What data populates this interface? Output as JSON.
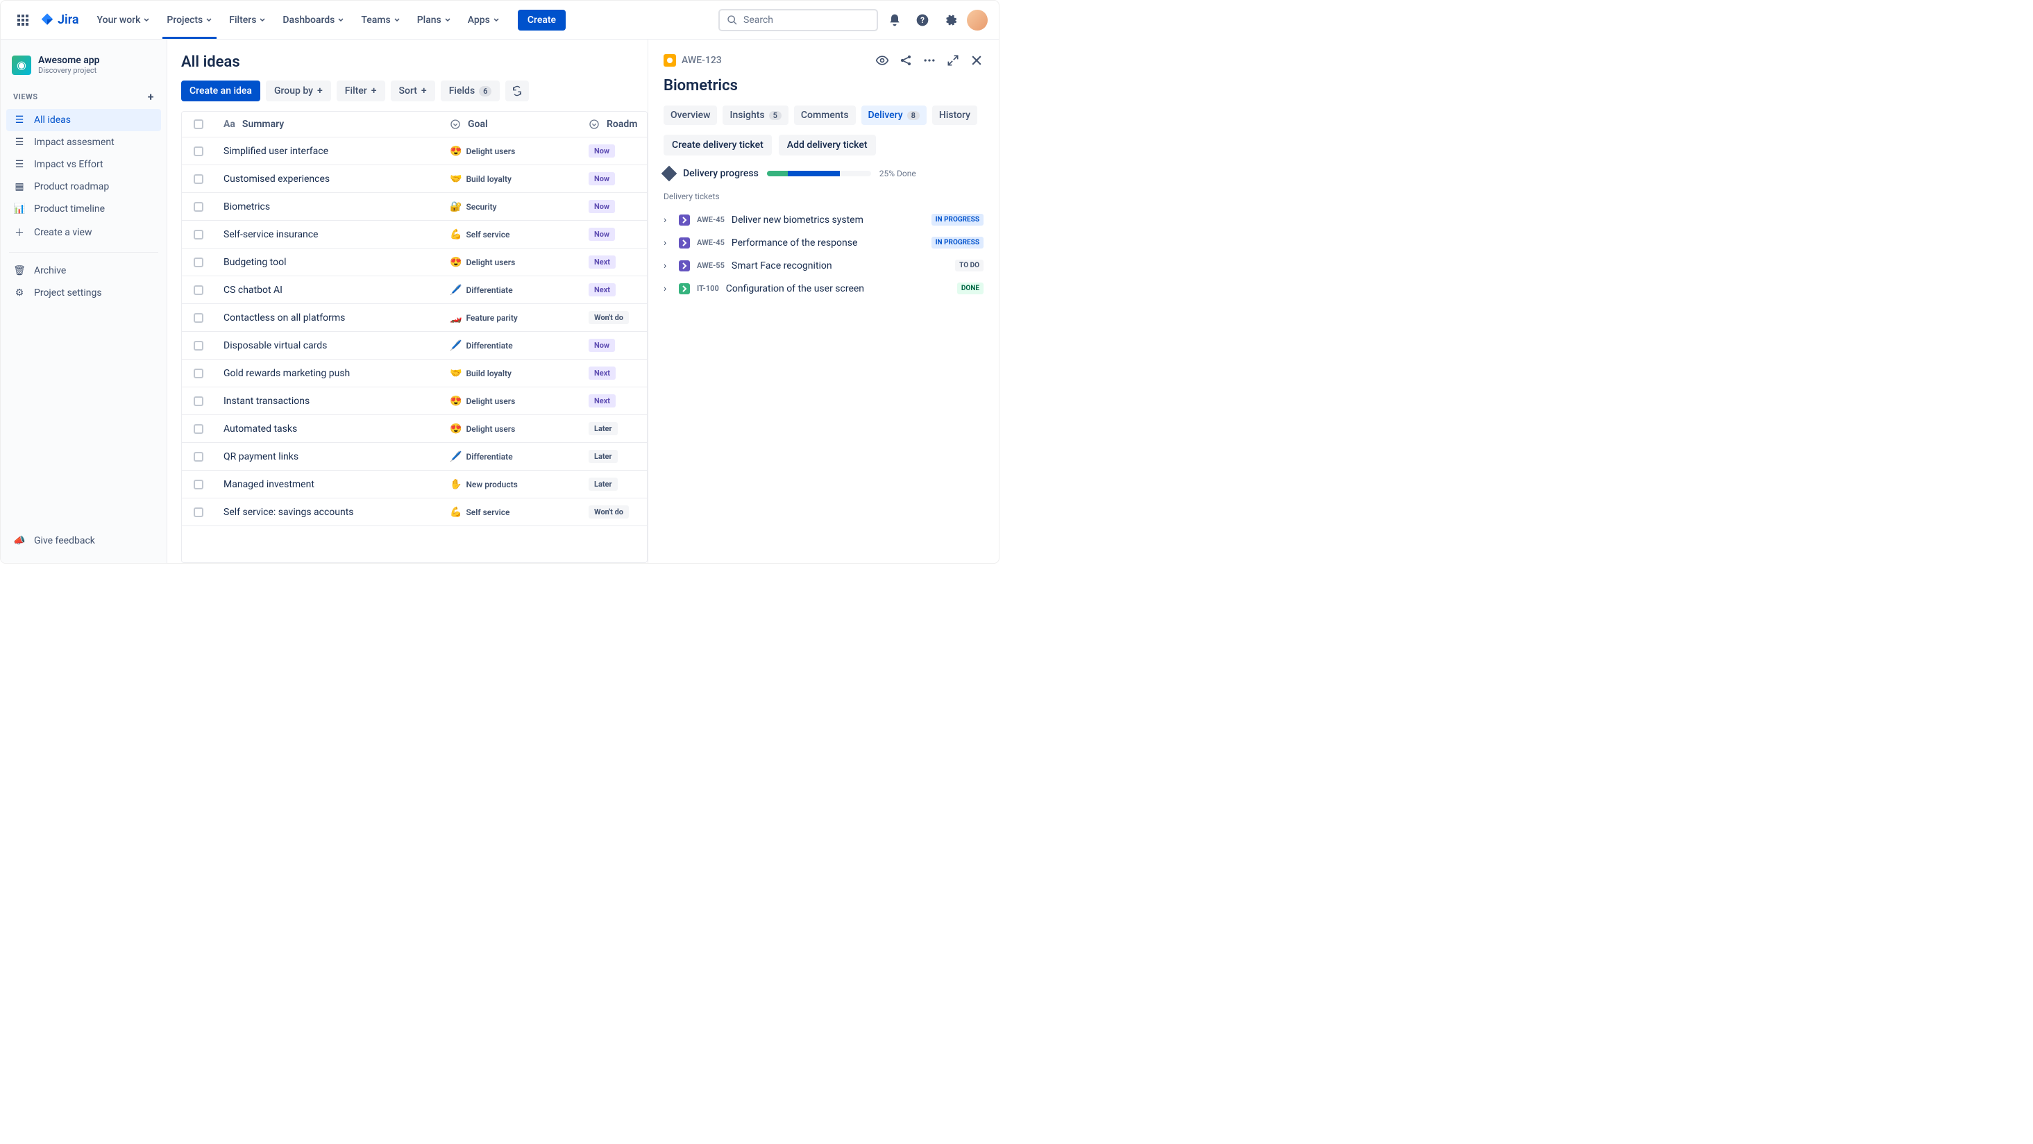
{
  "nav": {
    "product": "Jira",
    "items": [
      "Your work",
      "Projects",
      "Filters",
      "Dashboards",
      "Teams",
      "Plans",
      "Apps"
    ],
    "create": "Create",
    "searchPlaceholder": "Search"
  },
  "project": {
    "name": "Awesome app",
    "type": "Discovery project"
  },
  "sidebar": {
    "viewsLabel": "VIEWS",
    "items": [
      {
        "icon": "list",
        "label": "All ideas",
        "active": true
      },
      {
        "icon": "list",
        "label": "Impact assesment"
      },
      {
        "icon": "list",
        "label": "Impact vs Effort"
      },
      {
        "icon": "board",
        "label": "Product roadmap"
      },
      {
        "icon": "timeline",
        "label": "Product timeline"
      },
      {
        "icon": "plus",
        "label": "Create a view"
      }
    ],
    "bottom": [
      {
        "icon": "archive",
        "label": "Archive"
      },
      {
        "icon": "settings",
        "label": "Project settings"
      }
    ],
    "feedback": "Give feedback"
  },
  "main": {
    "title": "All ideas",
    "toolbar": {
      "create": "Create an idea",
      "groupBy": "Group by",
      "filter": "Filter",
      "sort": "Sort",
      "fields": "Fields",
      "fieldsCount": "6"
    },
    "columns": {
      "summary": "Summary",
      "goal": "Goal",
      "roadmap": "Roadm"
    },
    "rows": [
      {
        "summary": "Simplified user interface",
        "goalEmoji": "😍",
        "goal": "Delight users",
        "rd": "Now",
        "rdClass": "now"
      },
      {
        "summary": "Customised experiences",
        "goalEmoji": "🤝",
        "goal": "Build loyalty",
        "rd": "Now",
        "rdClass": "now"
      },
      {
        "summary": "Biometrics",
        "goalEmoji": "🔐",
        "goal": "Security",
        "rd": "Now",
        "rdClass": "now"
      },
      {
        "summary": "Self-service insurance",
        "goalEmoji": "💪",
        "goal": "Self service",
        "rd": "Now",
        "rdClass": "now"
      },
      {
        "summary": "Budgeting tool",
        "goalEmoji": "😍",
        "goal": "Delight users",
        "rd": "Next",
        "rdClass": "next"
      },
      {
        "summary": "CS chatbot AI",
        "goalEmoji": "🖊️",
        "goal": "Differentiate",
        "rd": "Next",
        "rdClass": "next"
      },
      {
        "summary": "Contactless on all platforms",
        "goalEmoji": "🏎️",
        "goal": "Feature parity",
        "rd": "Won't do",
        "rdClass": "wont"
      },
      {
        "summary": "Disposable virtual cards",
        "goalEmoji": "🖊️",
        "goal": "Differentiate",
        "rd": "Now",
        "rdClass": "now"
      },
      {
        "summary": "Gold rewards marketing push",
        "goalEmoji": "🤝",
        "goal": "Build loyalty",
        "rd": "Next",
        "rdClass": "next"
      },
      {
        "summary": "Instant transactions",
        "goalEmoji": "😍",
        "goal": "Delight users",
        "rd": "Next",
        "rdClass": "next"
      },
      {
        "summary": "Automated tasks",
        "goalEmoji": "😍",
        "goal": "Delight users",
        "rd": "Later",
        "rdClass": "later"
      },
      {
        "summary": "QR payment links",
        "goalEmoji": "🖊️",
        "goal": "Differentiate",
        "rd": "Later",
        "rdClass": "later"
      },
      {
        "summary": "Managed investment",
        "goalEmoji": "✋",
        "goal": "New products",
        "rd": "Later",
        "rdClass": "later"
      },
      {
        "summary": "Self service: savings accounts",
        "goalEmoji": "💪",
        "goal": "Self service",
        "rd": "Won't do",
        "rdClass": "wont"
      }
    ]
  },
  "detail": {
    "key": "AWE-123",
    "title": "Biometrics",
    "tabs": [
      {
        "label": "Overview"
      },
      {
        "label": "Insights",
        "count": "5"
      },
      {
        "label": "Comments"
      },
      {
        "label": "Delivery",
        "count": "8",
        "active": true
      },
      {
        "label": "History"
      }
    ],
    "actions": {
      "create": "Create delivery ticket",
      "add": "Add delivery ticket"
    },
    "progress": {
      "label": "Delivery progress",
      "greenPct": 20,
      "bluePct": 50,
      "text": "25% Done"
    },
    "ticketsLabel": "Delivery tickets",
    "tickets": [
      {
        "icon": "purple",
        "key": "AWE-45",
        "title": "Deliver new biometrics system",
        "status": "IN PROGRESS",
        "stClass": "progress"
      },
      {
        "icon": "purple",
        "key": "AWE-45",
        "title": "Performance of the response",
        "status": "IN PROGRESS",
        "stClass": "progress"
      },
      {
        "icon": "purple",
        "key": "AWE-55",
        "title": "Smart Face recognition",
        "status": "TO DO",
        "stClass": "todo"
      },
      {
        "icon": "green",
        "key": "IT-100",
        "title": "Configuration of the user screen",
        "status": "DONE",
        "stClass": "done"
      }
    ]
  }
}
